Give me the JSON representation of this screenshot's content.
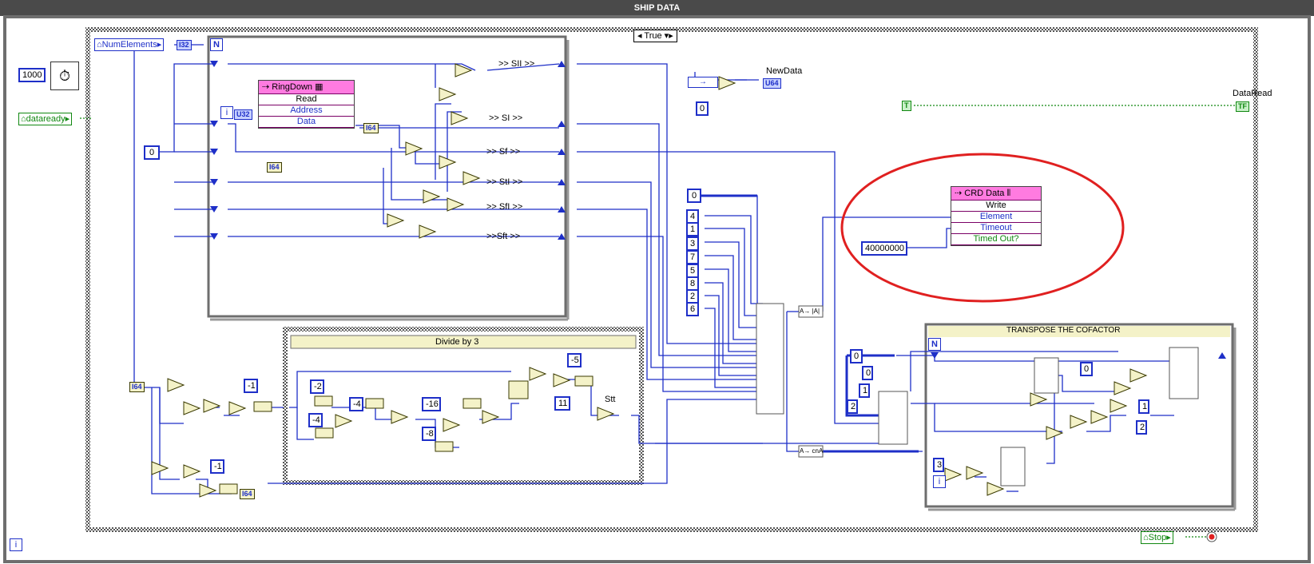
{
  "window": {
    "title": "SHIP DATA"
  },
  "case_structure": {
    "selector_value": "True",
    "arrows": "◂",
    "arrows_right": "▾▸"
  },
  "controls": {
    "timeout_ms": "1000",
    "dataready": "dataready",
    "num_elements": "NumElements",
    "zero_const": "0",
    "datatype_i32": "I32",
    "datatype_u32": "U32",
    "datatype_i64": "I64",
    "datatype_u64": "U64",
    "n_label": "N",
    "i_label": "i",
    "stop": "Stop",
    "data_read": "DataRead",
    "new_data": "NewData",
    "true_const": "T",
    "tf": "TF"
  },
  "ringdown_node": {
    "title": "RingDown",
    "rows": [
      "Read",
      "Address",
      "Data"
    ]
  },
  "crd_node": {
    "title": "CRD Data",
    "rows": [
      "Write",
      "Element",
      "Timeout",
      "Timed Out?"
    ],
    "timeout_value": "40000000"
  },
  "shift_registers": [
    ">> SII >>",
    ">> SI >>",
    ">> Sf >>",
    ">> StI >>",
    ">> SfI >>",
    ">>Sft >>"
  ],
  "divide_by_3": {
    "title": "Divide by 3",
    "consts": [
      "-2",
      "-4",
      "-4",
      "-16",
      "-8",
      "-1",
      "-5",
      "11",
      "-1"
    ],
    "out_label": "Stt"
  },
  "build_array_consts": [
    "0",
    "4",
    "1",
    "3",
    "7",
    "5",
    "8",
    "2",
    "6"
  ],
  "transpose": {
    "title": "TRANSPOSE THE COFACTOR",
    "consts": [
      "0",
      "0",
      "1",
      "2",
      "0",
      "1",
      "2",
      "3"
    ]
  },
  "array_fn_labels": [
    "A→ |A|",
    "A→ cnA"
  ],
  "colors": {
    "wire_blue": "#1e2fc8",
    "wire_green": "#118811",
    "node_pink": "#ff7be0",
    "annotation_red": "#e02020",
    "struct_gray": "#6e6e6e",
    "prim_yellow": "#f4f2c8"
  }
}
